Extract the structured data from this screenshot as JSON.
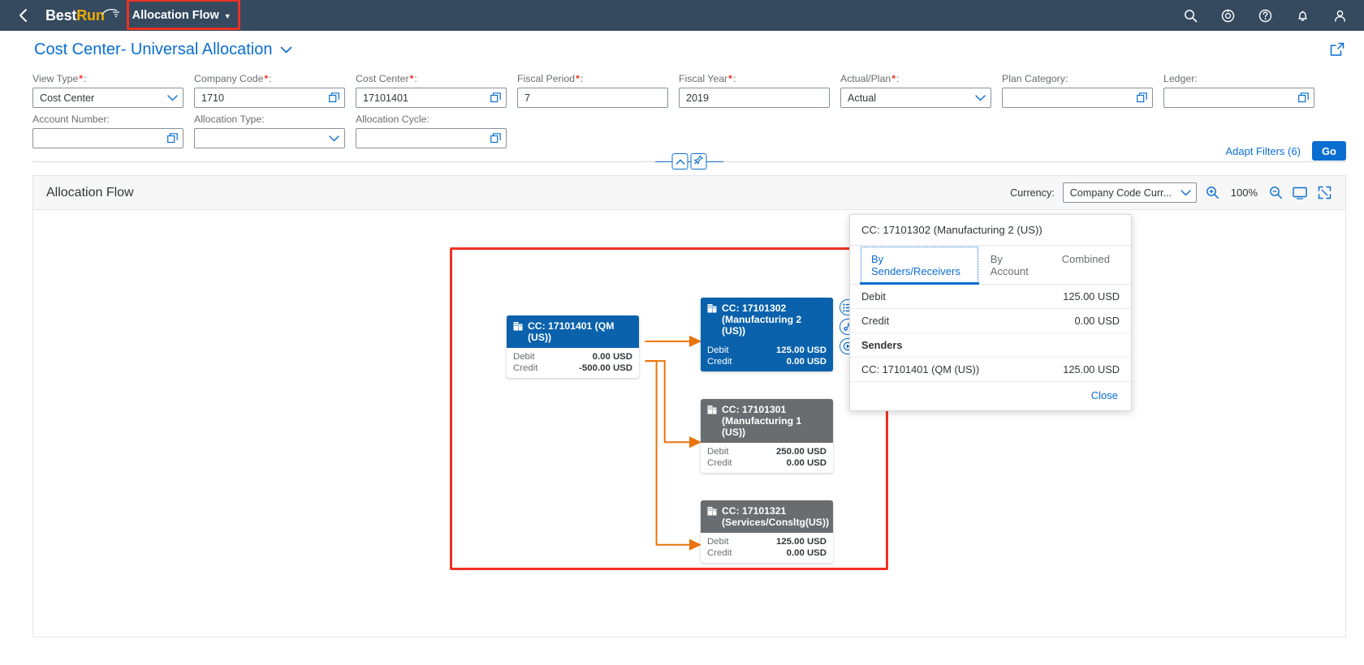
{
  "shell": {
    "back_icon": "chevron-left-icon",
    "brand_first": "Best",
    "brand_second": "Run",
    "app_title": "Allocation Flow",
    "app_title_caret": "▼",
    "actions": [
      {
        "name": "search-icon",
        "label": "Search"
      },
      {
        "name": "copilot-icon",
        "label": "Assistant"
      },
      {
        "name": "help-icon",
        "label": "Help"
      },
      {
        "name": "notifications-icon",
        "label": "Notifications"
      },
      {
        "name": "user-icon",
        "label": "User"
      }
    ]
  },
  "page": {
    "title": "Cost Center- Universal Allocation",
    "title_caret": "⌄",
    "share_icon": "share-icon"
  },
  "filters": {
    "row1": [
      {
        "label": "View Type",
        "required": true,
        "value": "Cost Center",
        "control": "select"
      },
      {
        "label": "Company Code",
        "required": true,
        "value": "1710",
        "control": "valuehelp"
      },
      {
        "label": "Cost Center",
        "required": true,
        "value": "17101401",
        "control": "valuehelp"
      },
      {
        "label": "Fiscal Period",
        "required": true,
        "value": "7",
        "control": "text"
      },
      {
        "label": "Fiscal Year",
        "required": true,
        "value": "2019",
        "control": "text"
      },
      {
        "label": "Actual/Plan",
        "required": true,
        "value": "Actual",
        "control": "select"
      },
      {
        "label": "Plan Category",
        "required": false,
        "value": "",
        "control": "valuehelp"
      },
      {
        "label": "Ledger",
        "required": false,
        "value": "",
        "control": "valuehelp"
      }
    ],
    "row2": [
      {
        "label": "Account Number",
        "required": false,
        "value": "",
        "control": "valuehelp"
      },
      {
        "label": "Allocation Type",
        "required": false,
        "value": "",
        "control": "select"
      },
      {
        "label": "Allocation Cycle",
        "required": false,
        "value": "",
        "control": "valuehelp"
      }
    ],
    "adapt_filters": "Adapt Filters (6)",
    "go": "Go",
    "collapse_icon": "chevron-up-icon",
    "pin_icon": "pin-icon"
  },
  "card": {
    "title": "Allocation Flow",
    "currency_label": "Currency:",
    "currency_value": "Company Code Curr...",
    "zoom_in_icon": "zoom-in-icon",
    "zoom_level": "100%",
    "zoom_out_icon": "zoom-out-icon",
    "fit_icon": "fit-to-screen-icon",
    "fullscreen_icon": "full-screen-icon"
  },
  "chart_data": {
    "type": "diagram",
    "title": "Allocation Flow",
    "currency": "USD",
    "nodes": [
      {
        "id": "17101401",
        "role": "sender",
        "style": "sender",
        "title_line1": "CC: 17101401 (QM (US))",
        "title_line2": "",
        "icon": "building-icon",
        "debit_label": "Debit",
        "debit_value": "0.00 USD",
        "credit_label": "Credit",
        "credit_value": "-500.00 USD"
      },
      {
        "id": "17101302",
        "role": "receiver",
        "style": "selected",
        "title_line1": "CC: 17101302",
        "title_line2": "(Manufacturing 2 (US))",
        "icon": "building-icon",
        "debit_label": "Debit",
        "debit_value": "125.00 USD",
        "credit_label": "Credit",
        "credit_value": "0.00 USD"
      },
      {
        "id": "17101301",
        "role": "receiver",
        "style": "grey",
        "title_line1": "CC: 17101301",
        "title_line2": "(Manufacturing 1 (US))",
        "icon": "building-icon",
        "debit_label": "Debit",
        "debit_value": "250.00 USD",
        "credit_label": "Credit",
        "credit_value": "0.00 USD"
      },
      {
        "id": "17101321",
        "role": "receiver",
        "style": "grey",
        "title_line1": "CC: 17101321",
        "title_line2": "(Services/Consltg(US))",
        "icon": "building-icon",
        "debit_label": "Debit",
        "debit_value": "125.00 USD",
        "credit_label": "Credit",
        "credit_value": "0.00 USD"
      }
    ],
    "edges": [
      {
        "from": "17101401",
        "to": "17101302",
        "value": "125.00 USD"
      },
      {
        "from": "17101401",
        "to": "17101301",
        "value": "250.00 USD"
      },
      {
        "from": "17101401",
        "to": "17101321",
        "value": "125.00 USD"
      }
    ],
    "edge_color": "#e9730c",
    "selected_node_color": "#0a62ac",
    "default_node_color": "#6a6d70",
    "highlight_color": "#ee3124"
  },
  "node_actions": [
    {
      "name": "details-list-icon"
    },
    {
      "name": "link-icon"
    },
    {
      "name": "drilldown-icon"
    }
  ],
  "popup": {
    "title": "CC: 17101302 (Manufacturing 2 (US))",
    "tabs": [
      {
        "label": "By Senders/Receivers",
        "active": true
      },
      {
        "label": "By Account",
        "active": false
      },
      {
        "label": "Combined",
        "active": false
      }
    ],
    "rows": [
      {
        "key": "Debit",
        "value": "125.00 USD",
        "header": false
      },
      {
        "key": "Credit",
        "value": "0.00 USD",
        "header": false
      },
      {
        "key": "Senders",
        "value": "",
        "header": true
      },
      {
        "key": "CC: 17101401 (QM (US))",
        "value": "125.00 USD",
        "header": false
      }
    ],
    "close": "Close"
  }
}
